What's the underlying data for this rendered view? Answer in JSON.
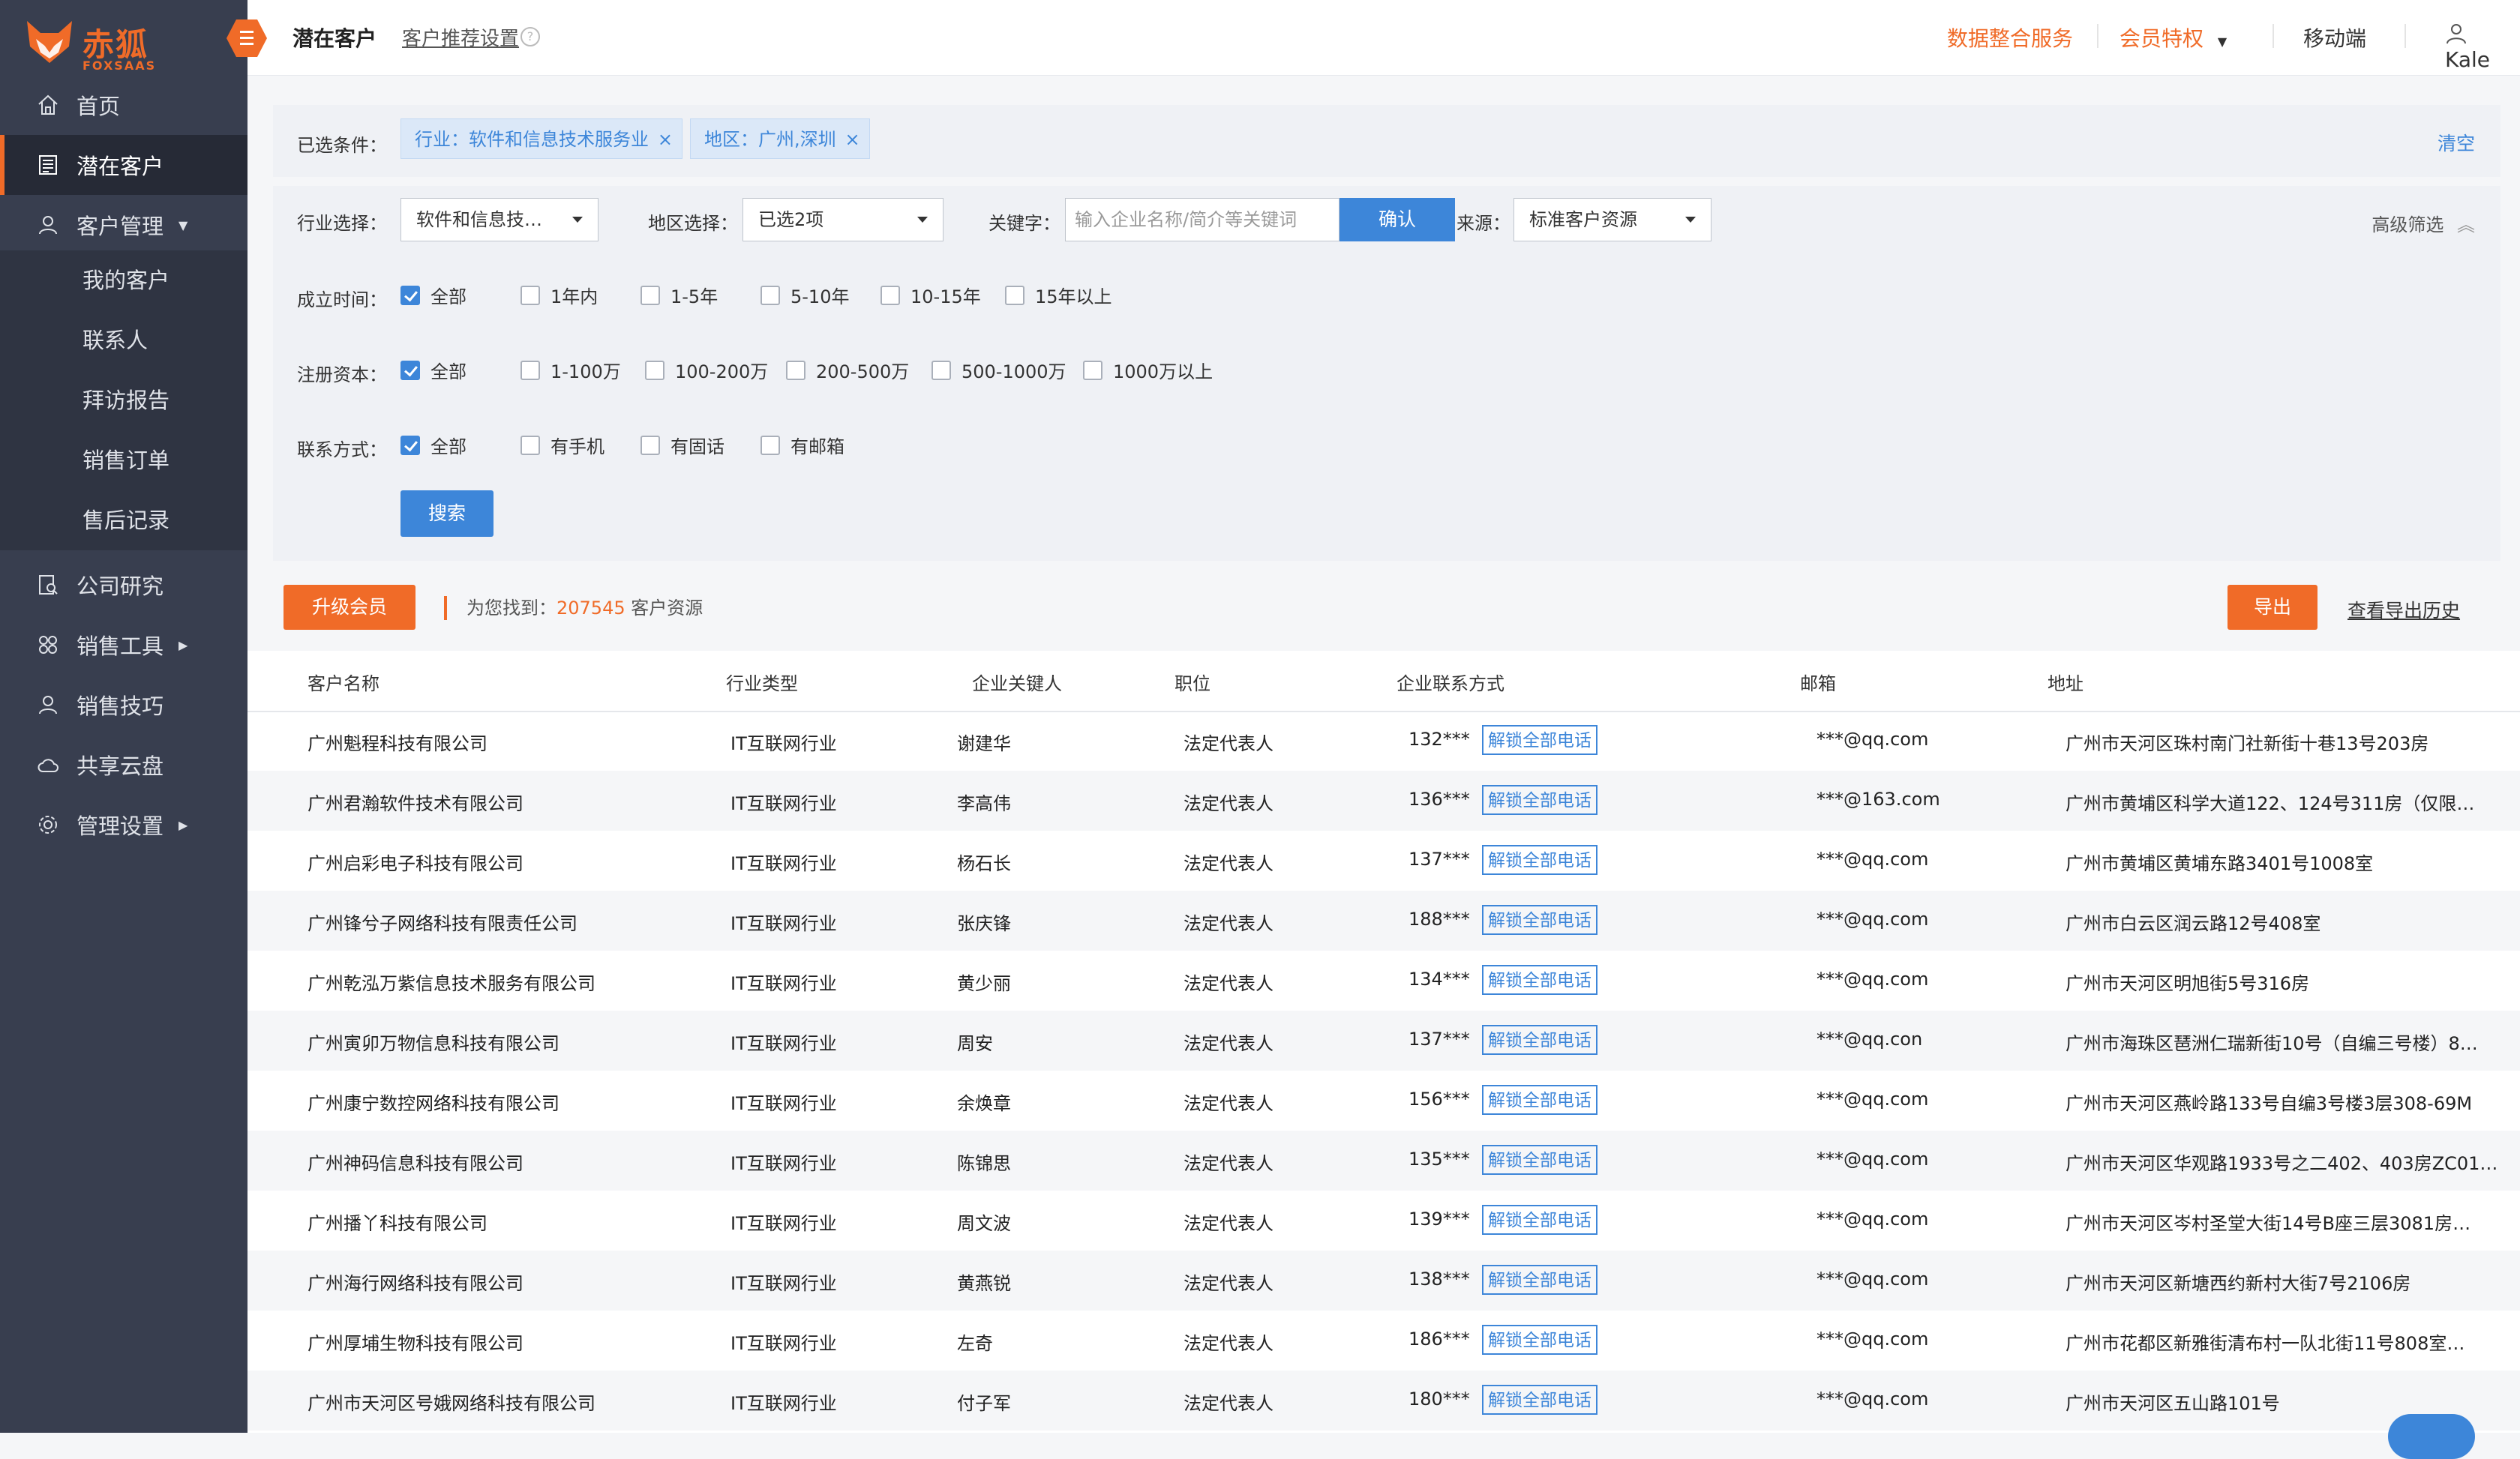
{
  "brand": {
    "name": "赤狐",
    "sub": "FOXSAAS",
    "color": "#f06b28"
  },
  "sidebar": {
    "items": [
      {
        "label": "首页",
        "icon": "home-icon"
      },
      {
        "label": "潜在客户",
        "icon": "list-icon",
        "active": true
      },
      {
        "label": "客户管理",
        "icon": "user-icon",
        "expanded": true
      },
      {
        "label": "公司研究",
        "icon": "research-icon"
      },
      {
        "label": "销售工具",
        "icon": "tools-icon"
      },
      {
        "label": "销售技巧",
        "icon": "skill-icon"
      },
      {
        "label": "共享云盘",
        "icon": "cloud-icon"
      },
      {
        "label": "管理设置",
        "icon": "gear-icon"
      }
    ],
    "sub_items": [
      "我的客户",
      "联系人",
      "拜访报告",
      "销售订单",
      "售后记录"
    ]
  },
  "topbar": {
    "title": "潜在客户",
    "setting": "客户推荐设置",
    "help": "?",
    "data_service": "数据整合服务",
    "vip": "会员特权",
    "mobile": "移动端",
    "user": "Kale"
  },
  "conditions": {
    "label": "已选条件：",
    "tags": [
      "行业：软件和信息技术服务业",
      "地区：广州,深圳"
    ],
    "clear": "清空"
  },
  "filters": {
    "industry_label": "行业选择：",
    "industry_value": "软件和信息技…",
    "region_label": "地区选择：",
    "region_value": "已选2项",
    "keyword_label": "关键字：",
    "keyword_placeholder": "输入企业名称/简介等关键词",
    "keyword_confirm": "确认",
    "source_label": "来源：",
    "source_value": "标准客户资源",
    "advanced": "高级筛选",
    "founded": {
      "label": "成立时间：",
      "options": [
        "全部",
        "1年内",
        "1-5年",
        "5-10年",
        "10-15年",
        "15年以上"
      ],
      "checked": 0
    },
    "capital": {
      "label": "注册资本：",
      "options": [
        "全部",
        "1-100万",
        "100-200万",
        "200-500万",
        "500-1000万",
        "1000万以上"
      ],
      "checked": 0
    },
    "contact": {
      "label": "联系方式：",
      "options": [
        "全部",
        "有手机",
        "有固话",
        "有邮箱"
      ],
      "checked": 0
    },
    "search": "搜索"
  },
  "results": {
    "upgrade": "升级会员",
    "found_prefix": "为您找到：",
    "found_count": "207545",
    "found_suffix": "客户资源",
    "export": "导出",
    "history": "查看导出历史"
  },
  "table": {
    "columns": [
      "客户名称",
      "行业类型",
      "企业关键人",
      "职位",
      "企业联系方式",
      "邮箱",
      "地址"
    ],
    "unlock_label": "解锁全部电话",
    "rows": [
      {
        "name": "广州魁程科技有限公司",
        "industry": "IT互联网行业",
        "person": "谢建华",
        "title": "法定代表人",
        "phone": "132***",
        "email": "***@qq.com",
        "address": "广州市天河区珠村南门社新街十巷13号203房"
      },
      {
        "name": "广州君瀚软件技术有限公司",
        "industry": "IT互联网行业",
        "person": "李高伟",
        "title": "法定代表人",
        "phone": "136***",
        "email": "***@163.com",
        "address": "广州市黄埔区科学大道122、124号311房（仅限…"
      },
      {
        "name": "广州启彩电子科技有限公司",
        "industry": "IT互联网行业",
        "person": "杨石长",
        "title": "法定代表人",
        "phone": "137***",
        "email": "***@qq.com",
        "address": "广州市黄埔区黄埔东路3401号1008室"
      },
      {
        "name": "广州锋兮子网络科技有限责任公司",
        "industry": "IT互联网行业",
        "person": "张庆锋",
        "title": "法定代表人",
        "phone": "188***",
        "email": "***@qq.com",
        "address": "广州市白云区润云路12号408室"
      },
      {
        "name": "广州乾泓万紫信息技术服务有限公司",
        "industry": "IT互联网行业",
        "person": "黄少丽",
        "title": "法定代表人",
        "phone": "134***",
        "email": "***@qq.com",
        "address": "广州市天河区明旭街5号316房"
      },
      {
        "name": "广州寅卯万物信息科技有限公司",
        "industry": "IT互联网行业",
        "person": "周安",
        "title": "法定代表人",
        "phone": "137***",
        "email": "***@qq.con",
        "address": "广州市海珠区琶洲仁瑞新街10号（自编三号楼）8…"
      },
      {
        "name": "广州康宁数控网络科技有限公司",
        "industry": "IT互联网行业",
        "person": "余焕章",
        "title": "法定代表人",
        "phone": "156***",
        "email": "***@qq.com",
        "address": "广州市天河区燕岭路133号自编3号楼3层308-69M"
      },
      {
        "name": "广州神码信息科技有限公司",
        "industry": "IT互联网行业",
        "person": "陈锦思",
        "title": "法定代表人",
        "phone": "135***",
        "email": "***@qq.com",
        "address": "广州市天河区华观路1933号之二402、403房ZC01…"
      },
      {
        "name": "广州播丫科技有限公司",
        "industry": "IT互联网行业",
        "person": "周文波",
        "title": "法定代表人",
        "phone": "139***",
        "email": "***@qq.com",
        "address": "广州市天河区岑村圣堂大街14号B座三层3081房…"
      },
      {
        "name": "广州海行网络科技有限公司",
        "industry": "IT互联网行业",
        "person": "黄燕锐",
        "title": "法定代表人",
        "phone": "138***",
        "email": "***@qq.com",
        "address": "广州市天河区新塘西约新村大街7号2106房"
      },
      {
        "name": "广州厚埔生物科技有限公司",
        "industry": "IT互联网行业",
        "person": "左奇",
        "title": "法定代表人",
        "phone": "186***",
        "email": "***@qq.com",
        "address": "广州市花都区新雅街清布村一队北街11号808室…"
      },
      {
        "name": "广州市天河区号娥网络科技有限公司",
        "industry": "IT互联网行业",
        "person": "付子军",
        "title": "法定代表人",
        "phone": "180***",
        "email": "***@qq.com",
        "address": "广州市天河区五山路101号"
      }
    ]
  }
}
